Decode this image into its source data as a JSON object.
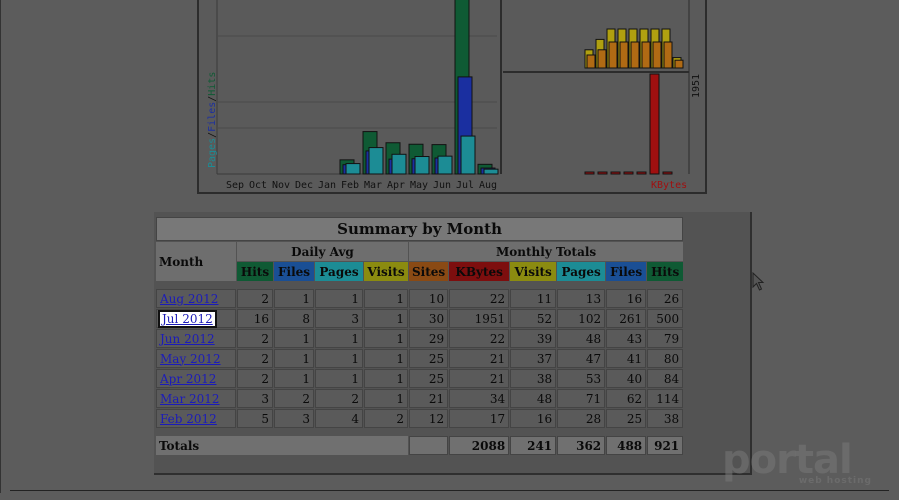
{
  "chart": {
    "months": [
      "Sep",
      "Oct",
      "Nov",
      "Dec",
      "Jan",
      "Feb",
      "Mar",
      "Apr",
      "May",
      "Jun",
      "Jul",
      "Aug"
    ],
    "left_axis_label_parts": [
      "Pages",
      "/",
      "Files",
      "/",
      "Hits"
    ],
    "right_axis_value": "1951",
    "right_axis_label": "KBytes",
    "colors": {
      "hits": "#0f5a34",
      "files": "#1a2fa0",
      "pages": "#1c8c95",
      "kbytes": "#a01010",
      "visits": "#b0a010",
      "sites": "#b06a14"
    }
  },
  "summary": {
    "title": "Summary by Month",
    "month_header": "Month",
    "daily_avg_header": "Daily Avg",
    "monthly_totals_header": "Monthly Totals",
    "daily_cols": [
      "Hits",
      "Files",
      "Pages",
      "Visits"
    ],
    "monthly_cols": [
      "Sites",
      "KBytes",
      "Visits",
      "Pages",
      "Files",
      "Hits"
    ],
    "rows": [
      {
        "month": "Aug 2012",
        "d": [
          "2",
          "1",
          "1",
          "1"
        ],
        "m": [
          "10",
          "22",
          "11",
          "13",
          "16",
          "26"
        ]
      },
      {
        "month": "Jul 2012",
        "d": [
          "16",
          "8",
          "3",
          "1"
        ],
        "m": [
          "30",
          "1951",
          "52",
          "102",
          "261",
          "500"
        ]
      },
      {
        "month": "Jun 2012",
        "d": [
          "2",
          "1",
          "1",
          "1"
        ],
        "m": [
          "29",
          "22",
          "39",
          "48",
          "43",
          "79"
        ]
      },
      {
        "month": "May 2012",
        "d": [
          "2",
          "1",
          "1",
          "1"
        ],
        "m": [
          "25",
          "21",
          "37",
          "47",
          "41",
          "80"
        ]
      },
      {
        "month": "Apr 2012",
        "d": [
          "2",
          "1",
          "1",
          "1"
        ],
        "m": [
          "25",
          "21",
          "38",
          "53",
          "40",
          "84"
        ]
      },
      {
        "month": "Mar 2012",
        "d": [
          "3",
          "2",
          "2",
          "1"
        ],
        "m": [
          "21",
          "34",
          "48",
          "71",
          "62",
          "114"
        ]
      },
      {
        "month": "Feb 2012",
        "d": [
          "5",
          "3",
          "4",
          "2"
        ],
        "m": [
          "12",
          "17",
          "16",
          "28",
          "25",
          "38"
        ]
      }
    ],
    "totals_label": "Totals",
    "totals": [
      "2088",
      "241",
      "362",
      "488",
      "921"
    ]
  },
  "watermark": {
    "brand": "portal",
    "tagline": "web hosting"
  }
}
